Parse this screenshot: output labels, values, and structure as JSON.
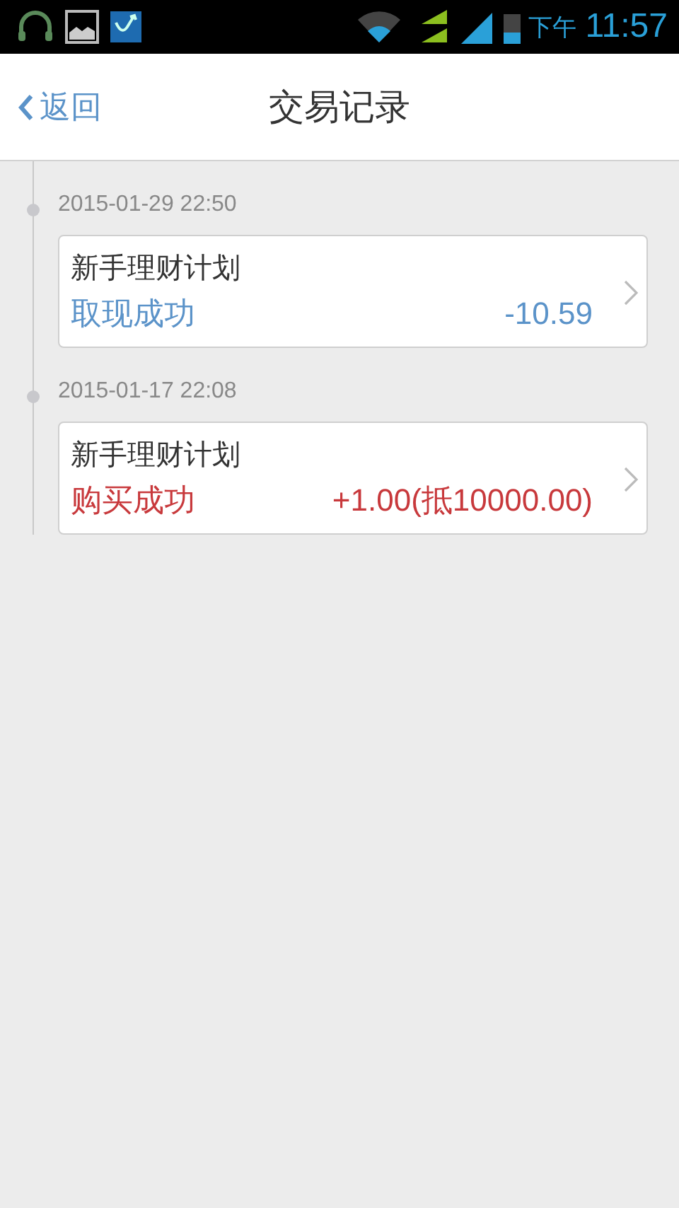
{
  "status_bar": {
    "period": "下午",
    "time": "11:57"
  },
  "nav": {
    "back": "返回",
    "title": "交易记录"
  },
  "records": [
    {
      "time": "2015-01-29 22:50",
      "product": "新手理财计划",
      "status": "取现成功",
      "amount": "-10.59",
      "kind": "withdraw"
    },
    {
      "time": "2015-01-17 22:08",
      "product": "新手理财计划",
      "status": "购买成功",
      "amount": "+1.00(抵10000.00)",
      "kind": "purchase"
    }
  ]
}
